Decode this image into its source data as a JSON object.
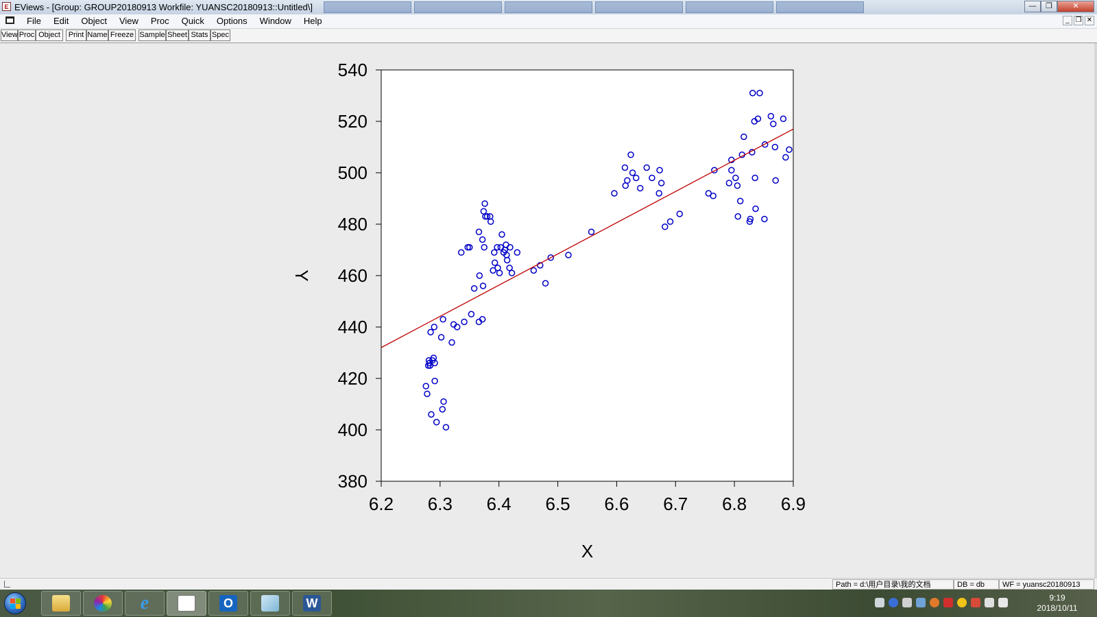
{
  "window": {
    "title": "EViews - [Group: GROUP20180913   Workfile: YUANSC20180913::Untitled\\]",
    "app_icon": "eviews-icon",
    "controls": [
      "minimize-icon",
      "maximize-icon",
      "close-icon"
    ]
  },
  "menubar": {
    "items": [
      "File",
      "Edit",
      "Object",
      "View",
      "Proc",
      "Quick",
      "Options",
      "Window",
      "Help"
    ]
  },
  "toolbar": {
    "buttons": [
      "View",
      "Proc",
      "Object",
      "Print",
      "Name",
      "Freeze",
      "Sample",
      "Sheet",
      "Stats",
      "Spec"
    ]
  },
  "chart_data": {
    "type": "scatter",
    "xlabel": "X",
    "ylabel": "Y",
    "xlim": [
      6.2,
      6.9
    ],
    "ylim": [
      380,
      540
    ],
    "xticks": [
      "6.2",
      "6.3",
      "6.4",
      "6.5",
      "6.6",
      "6.7",
      "6.8",
      "6.9"
    ],
    "yticks": [
      "380",
      "400",
      "420",
      "440",
      "460",
      "480",
      "500",
      "520",
      "540"
    ],
    "marker_color": "#0000c8",
    "fit_line_color": "#c00000",
    "fit_line": {
      "x": [
        6.2,
        6.9
      ],
      "y": [
        432,
        517
      ]
    },
    "points": [
      [
        6.276,
        417
      ],
      [
        6.278,
        414
      ],
      [
        6.28,
        425
      ],
      [
        6.281,
        427
      ],
      [
        6.282,
        426
      ],
      [
        6.283,
        425
      ],
      [
        6.285,
        406
      ],
      [
        6.284,
        438
      ],
      [
        6.287,
        427
      ],
      [
        6.289,
        428
      ],
      [
        6.29,
        440
      ],
      [
        6.291,
        426
      ],
      [
        6.291,
        419
      ],
      [
        6.294,
        403
      ],
      [
        6.302,
        436
      ],
      [
        6.304,
        408
      ],
      [
        6.305,
        443
      ],
      [
        6.306,
        411
      ],
      [
        6.31,
        401
      ],
      [
        6.32,
        434
      ],
      [
        6.323,
        441
      ],
      [
        6.329,
        440
      ],
      [
        6.336,
        469
      ],
      [
        6.341,
        442
      ],
      [
        6.347,
        471
      ],
      [
        6.35,
        471
      ],
      [
        6.353,
        445
      ],
      [
        6.358,
        455
      ],
      [
        6.366,
        442
      ],
      [
        6.366,
        477
      ],
      [
        6.367,
        460
      ],
      [
        6.372,
        443
      ],
      [
        6.372,
        474
      ],
      [
        6.373,
        456
      ],
      [
        6.374,
        485
      ],
      [
        6.375,
        471
      ],
      [
        6.376,
        488
      ],
      [
        6.377,
        483
      ],
      [
        6.38,
        483
      ],
      [
        6.385,
        483
      ],
      [
        6.386,
        481
      ],
      [
        6.39,
        462
      ],
      [
        6.392,
        469
      ],
      [
        6.393,
        465
      ],
      [
        6.397,
        471
      ],
      [
        6.398,
        463
      ],
      [
        6.401,
        461
      ],
      [
        6.403,
        471
      ],
      [
        6.405,
        476
      ],
      [
        6.408,
        469
      ],
      [
        6.41,
        470
      ],
      [
        6.412,
        472
      ],
      [
        6.413,
        468
      ],
      [
        6.414,
        466
      ],
      [
        6.418,
        463
      ],
      [
        6.419,
        471
      ],
      [
        6.422,
        461
      ],
      [
        6.431,
        469
      ],
      [
        6.459,
        462
      ],
      [
        6.47,
        464
      ],
      [
        6.479,
        457
      ],
      [
        6.488,
        467
      ],
      [
        6.518,
        468
      ],
      [
        6.557,
        477
      ],
      [
        6.596,
        492
      ],
      [
        6.614,
        502
      ],
      [
        6.615,
        495
      ],
      [
        6.618,
        497
      ],
      [
        6.624,
        507
      ],
      [
        6.627,
        500
      ],
      [
        6.633,
        498
      ],
      [
        6.64,
        494
      ],
      [
        6.651,
        502
      ],
      [
        6.66,
        498
      ],
      [
        6.672,
        492
      ],
      [
        6.673,
        501
      ],
      [
        6.676,
        496
      ],
      [
        6.682,
        479
      ],
      [
        6.691,
        481
      ],
      [
        6.707,
        484
      ],
      [
        6.756,
        492
      ],
      [
        6.764,
        491
      ],
      [
        6.766,
        501
      ],
      [
        6.791,
        496
      ],
      [
        6.795,
        505
      ],
      [
        6.795,
        501
      ],
      [
        6.802,
        498
      ],
      [
        6.805,
        495
      ],
      [
        6.806,
        483
      ],
      [
        6.81,
        489
      ],
      [
        6.813,
        507
      ],
      [
        6.816,
        514
      ],
      [
        6.826,
        481
      ],
      [
        6.827,
        482
      ],
      [
        6.83,
        508
      ],
      [
        6.831,
        531
      ],
      [
        6.834,
        520
      ],
      [
        6.835,
        498
      ],
      [
        6.836,
        486
      ],
      [
        6.84,
        521
      ],
      [
        6.843,
        531
      ],
      [
        6.851,
        482
      ],
      [
        6.852,
        511
      ],
      [
        6.862,
        522
      ],
      [
        6.866,
        519
      ],
      [
        6.869,
        510
      ],
      [
        6.87,
        497
      ],
      [
        6.883,
        521
      ],
      [
        6.887,
        506
      ],
      [
        6.893,
        509
      ]
    ]
  },
  "statusbar": {
    "path": "Path = d:\\用户目录\\我的文档",
    "db": "DB = db",
    "wf": "WF = yuansc20180913"
  },
  "taskbar": {
    "apps": [
      "windows-explorer",
      "picasa",
      "internet-explorer",
      "eviews",
      "outlook",
      "notepad",
      "word"
    ],
    "time": "9:19",
    "date": "2018/10/11"
  }
}
